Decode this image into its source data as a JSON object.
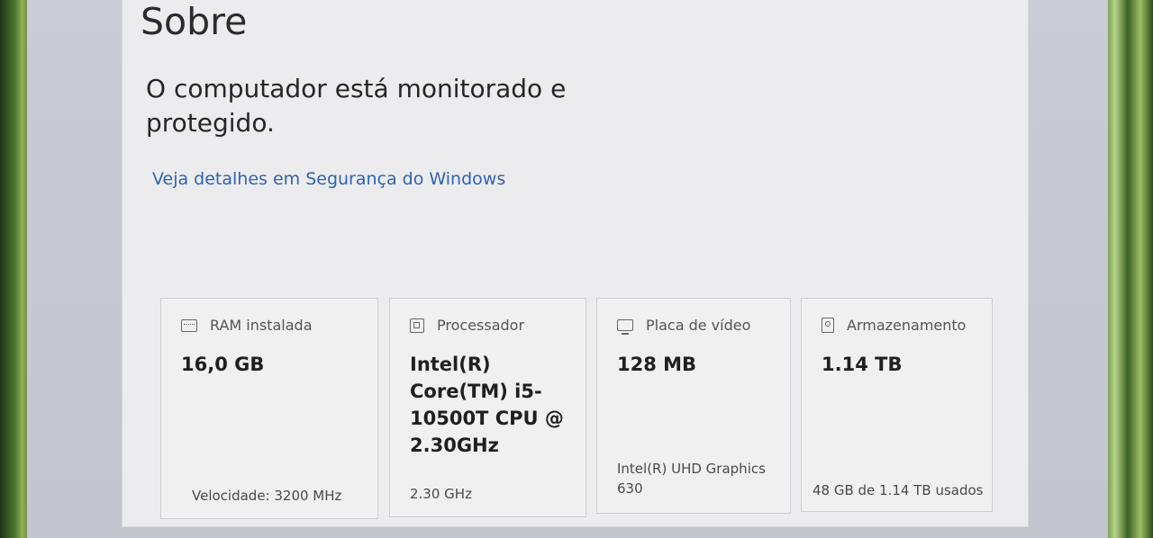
{
  "page": {
    "title": "Sobre",
    "status_text": "O computador está monitorado e protegido.",
    "security_link": "Veja detalhes em Segurança do Windows"
  },
  "cards": [
    {
      "icon": "ram-icon",
      "label": "RAM instalada",
      "value": "16,0 GB",
      "detail": "Velocidade: 3200 MHz"
    },
    {
      "icon": "cpu-icon",
      "label": "Processador",
      "value": "Intel(R) Core(TM) i5-10500T CPU @ 2.30GHz",
      "detail": "2.30 GHz"
    },
    {
      "icon": "gpu-icon",
      "label": "Placa de vídeo",
      "value": "128 MB",
      "detail": "Intel(R) UHD Graphics 630"
    },
    {
      "icon": "storage-icon",
      "label": "Armazenamento",
      "value": "1.14 TB",
      "detail": "48 GB de 1.14 TB usados"
    }
  ],
  "colors": {
    "link": "#2f64b0",
    "background": "#ececee"
  }
}
